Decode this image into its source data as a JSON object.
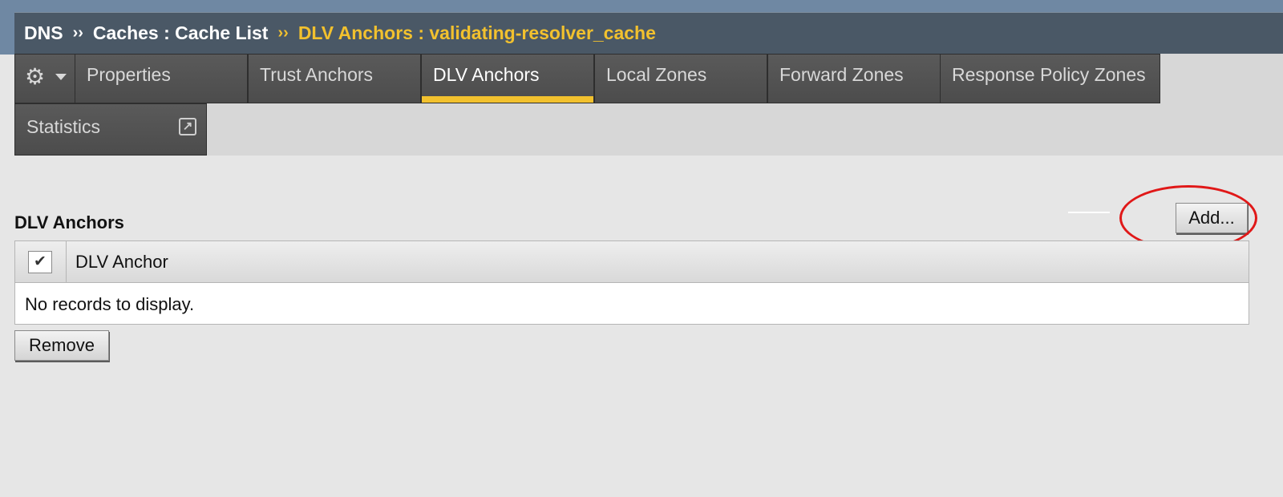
{
  "breadcrumb": {
    "root": "DNS",
    "parent": "Caches : Cache List",
    "current": "DLV Anchors : validating-resolver_cache",
    "separator": "››"
  },
  "tabs": {
    "items": [
      {
        "label": "Properties"
      },
      {
        "label": "Trust Anchors"
      },
      {
        "label": "DLV Anchors",
        "active": true
      },
      {
        "label": "Local Zones"
      },
      {
        "label": "Forward Zones"
      },
      {
        "label": "Response Policy Zones"
      },
      {
        "label": "Statistics"
      }
    ],
    "gear_icon": "gear-icon",
    "external_icon": "external-link-icon",
    "active_color": "#f2c12e"
  },
  "section": {
    "title": "DLV Anchors",
    "add_label": "Add...",
    "remove_label": "Remove"
  },
  "table": {
    "columns": [
      "DLV Anchor"
    ],
    "header_checkbox": "✔",
    "empty_message": "No records to display."
  },
  "colors": {
    "header_bg": "#4a5866",
    "accent": "#f2c12e",
    "highlight": "#e01818"
  }
}
